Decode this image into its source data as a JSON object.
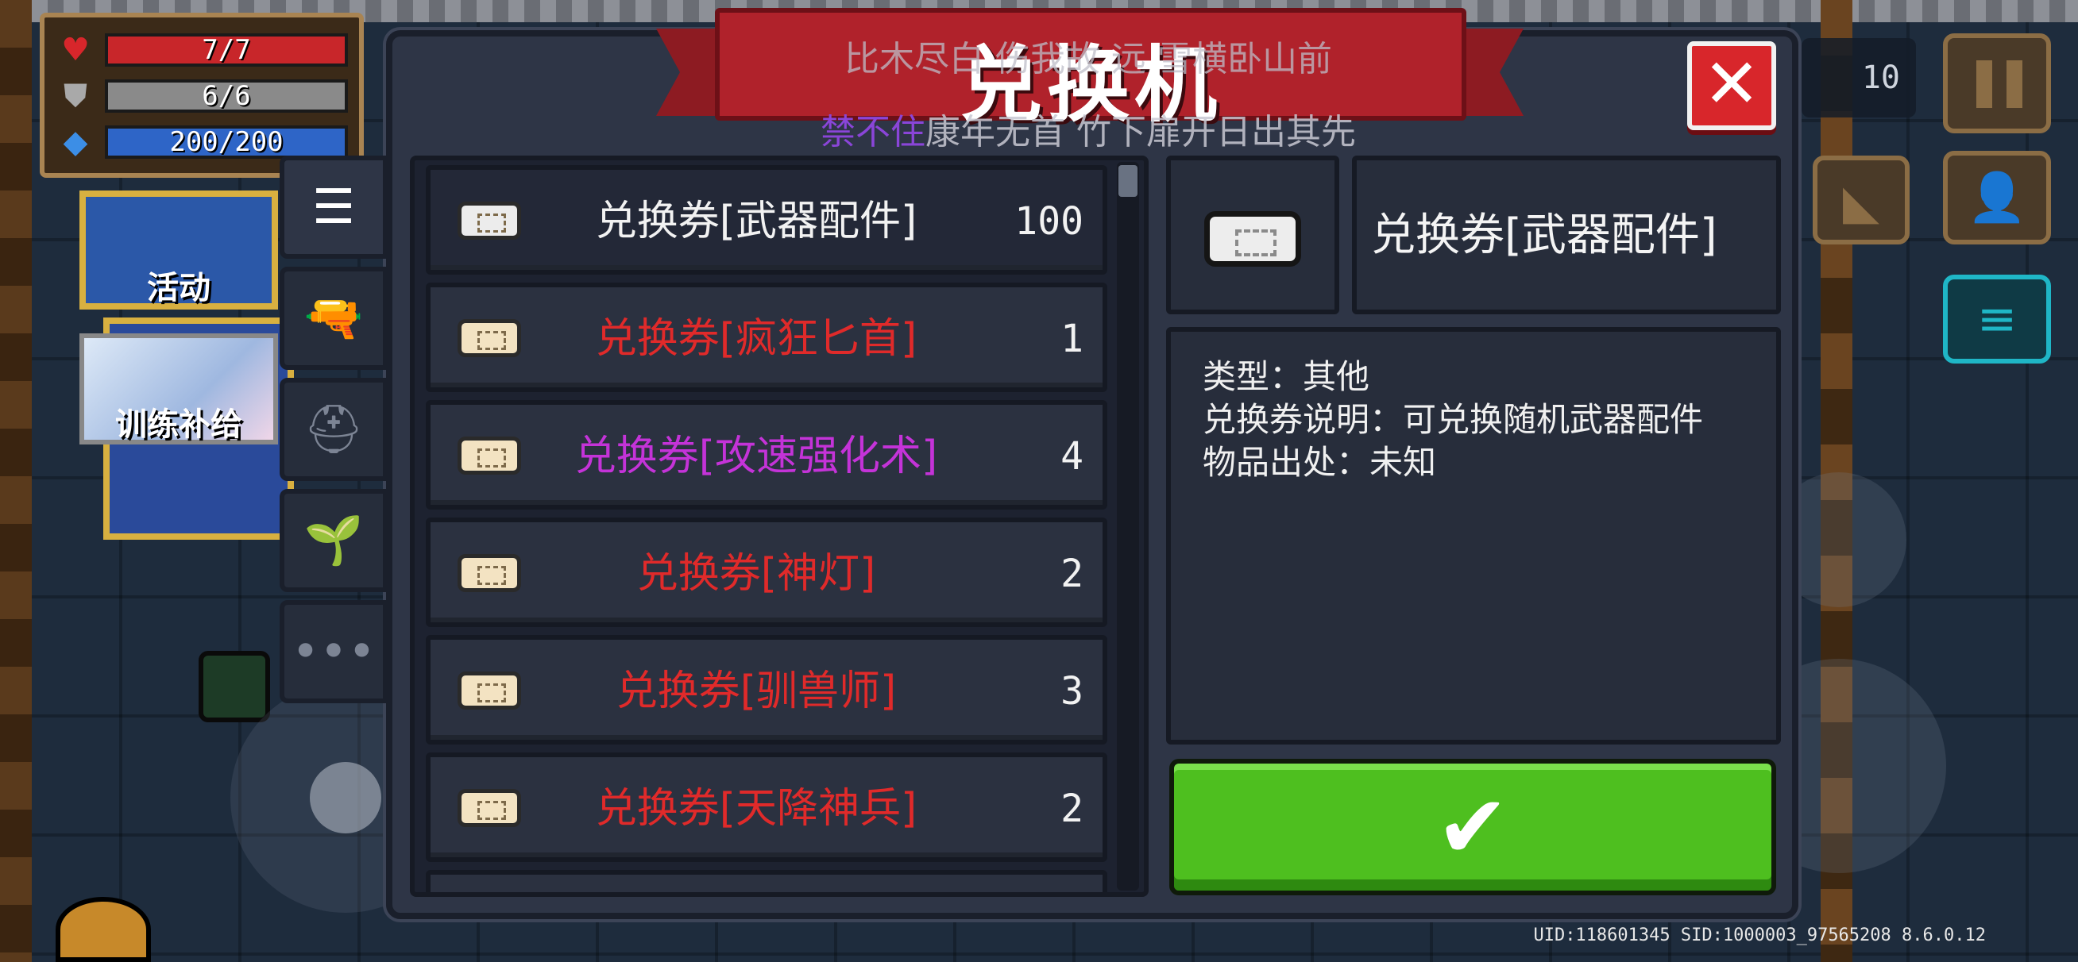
{
  "hud": {
    "hp": "7/7",
    "armor": "6/6",
    "energy": "200/200",
    "coins": "10"
  },
  "background": {
    "event_label": "活动",
    "training_label": "训练补给"
  },
  "lyrics": {
    "line1": "比木尽白 伤我故 远 雪横卧山前",
    "line2_highlight": "禁不住",
    "line2_rest": "康年无首 竹下扉开日出其先"
  },
  "dialog": {
    "title": "兑换机",
    "close_icon": "close-icon",
    "tabs": [
      {
        "icon": "list-icon",
        "glyph": "☰"
      },
      {
        "icon": "weapon-icon",
        "glyph": "🔫"
      },
      {
        "icon": "helmet-icon",
        "glyph": "⛑"
      },
      {
        "icon": "plant-icon",
        "glyph": "🌱"
      },
      {
        "icon": "more-icon",
        "glyph": "•••"
      }
    ],
    "items": [
      {
        "name": "兑换券[武器配件]",
        "count": "100",
        "color": "#f2f2f2",
        "ticket": "white"
      },
      {
        "name": "兑换券[疯狂匕首]",
        "count": "1",
        "color": "#e02a2a",
        "ticket": "gold"
      },
      {
        "name": "兑换券[攻速强化术]",
        "count": "4",
        "color": "#c433d8",
        "ticket": "gold"
      },
      {
        "name": "兑换券[神灯]",
        "count": "2",
        "color": "#e02a2a",
        "ticket": "gold"
      },
      {
        "name": "兑换券[驯兽师]",
        "count": "3",
        "color": "#e02a2a",
        "ticket": "gold"
      },
      {
        "name": "兑换券[天降神兵]",
        "count": "2",
        "color": "#e02a2a",
        "ticket": "gold"
      }
    ],
    "detail": {
      "name": "兑换券[武器配件]",
      "type_line": "类型：其他",
      "desc_line": "兑换券说明：可兑换随机武器配件",
      "origin_line": "物品出处：未知"
    },
    "confirm_icon": "checkmark-icon"
  },
  "footer": {
    "uid": "UID:118601345 SID:1000003_97565208 8.6.0.12"
  },
  "colors": {
    "panel": "#2e3546",
    "ribbon": "#b0222b",
    "confirm": "#4ebf1f",
    "close": "#d8262b"
  }
}
